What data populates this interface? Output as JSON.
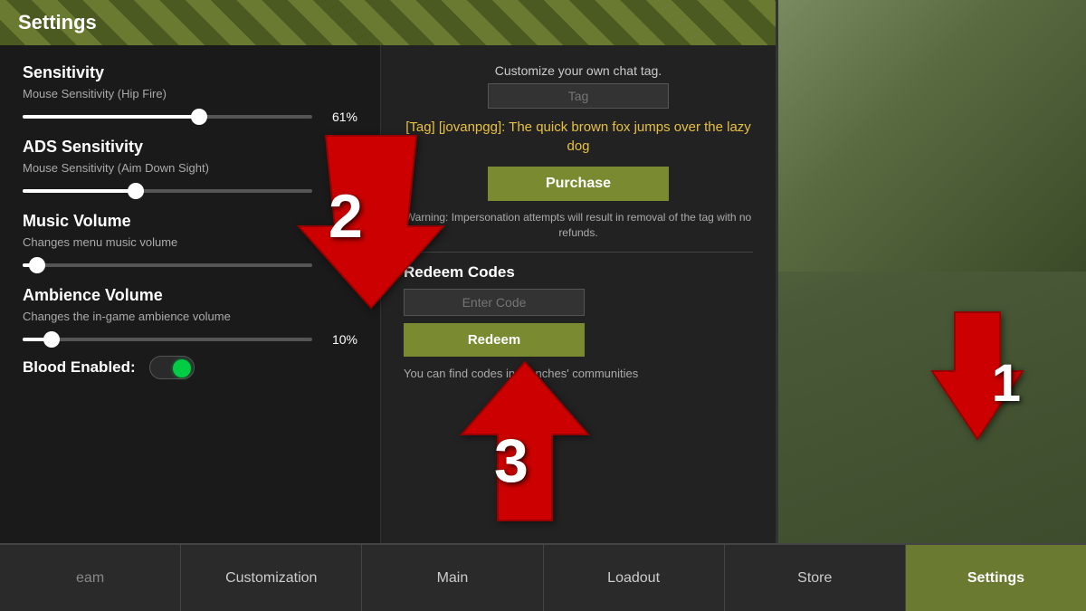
{
  "panel": {
    "title": "Settings"
  },
  "sensitivity": {
    "title": "Sensitivity",
    "mouse_hip_label": "Mouse Sensitivity (Hip Fire)",
    "hip_value": "61%",
    "hip_percent": 61,
    "ads_title": "ADS Sensitivity",
    "mouse_ads_label": "Mouse Sensitivity (Aim Down Sight)",
    "ads_value": "39%",
    "ads_percent": 39
  },
  "music": {
    "title": "Music Volume",
    "desc": "Changes menu music volume",
    "value": "2",
    "percent": 5
  },
  "ambience": {
    "title": "Ambience Volume",
    "desc": "Changes the in-game ambience volume",
    "value": "10%",
    "percent": 10
  },
  "blood": {
    "label": "Blood Enabled:",
    "enabled": true
  },
  "chat_tag": {
    "title": "Customize your own chat tag.",
    "input_placeholder": "Tag",
    "preview": "[Tag] [jovanpgg]: The quick brown fox jumps over the lazy dog",
    "purchase_label": "Purchase",
    "warning": "Warning: Impersonation attempts will result in removal of the tag with no refunds."
  },
  "redeem": {
    "title": "Redeem Codes",
    "input_placeholder": "Enter Code",
    "button_label": "Redeem",
    "info": "You can find codes in Trenches' communities"
  },
  "nav": {
    "items": [
      {
        "label": "eam",
        "active": false
      },
      {
        "label": "Customization",
        "active": false
      },
      {
        "label": "Main",
        "active": false
      },
      {
        "label": "Loadout",
        "active": false
      },
      {
        "label": "Store",
        "active": false
      },
      {
        "label": "Settings",
        "active": true
      }
    ]
  },
  "arrows": {
    "arrow1_number": "1",
    "arrow2_number": "2",
    "arrow3_number": "3"
  }
}
